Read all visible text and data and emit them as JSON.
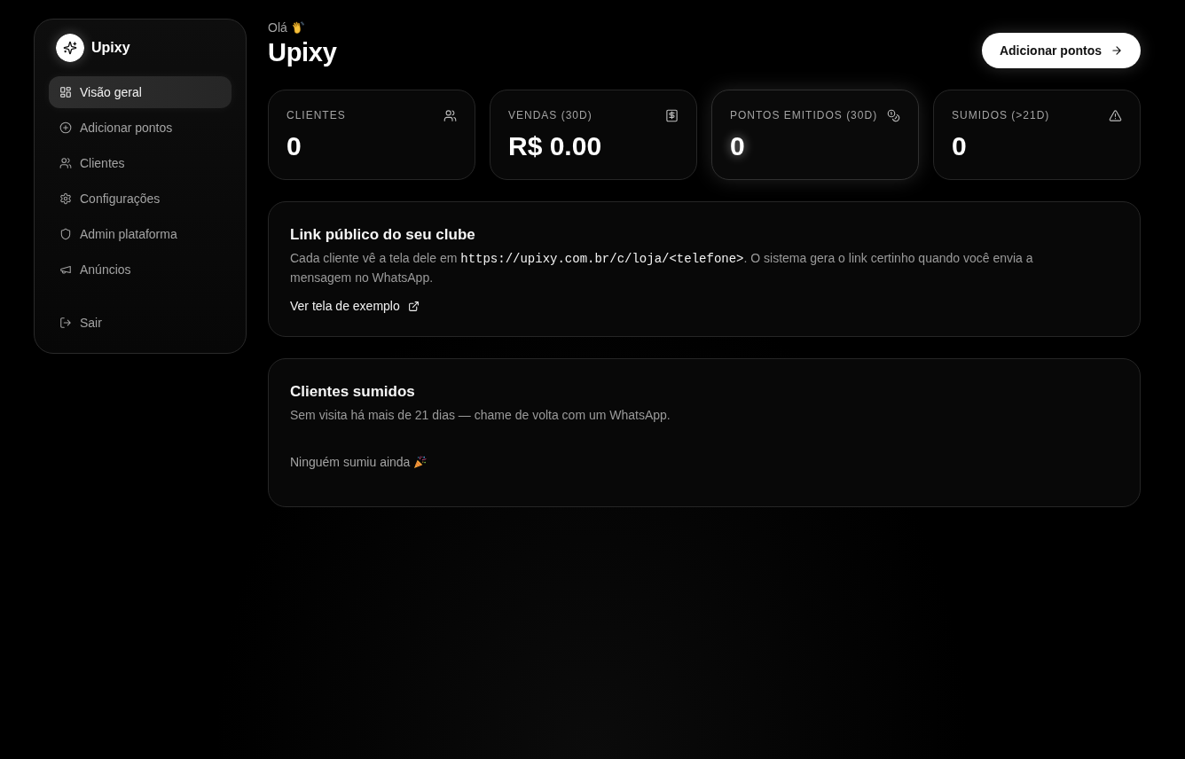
{
  "sidebar": {
    "brand": "Upixy",
    "items": [
      {
        "label": "Visão geral",
        "selected": true
      },
      {
        "label": "Adicionar pontos",
        "selected": false
      },
      {
        "label": "Clientes",
        "selected": false
      },
      {
        "label": "Configurações",
        "selected": false
      },
      {
        "label": "Admin plataforma",
        "selected": false
      },
      {
        "label": "Anúncios",
        "selected": false
      }
    ],
    "logout": {
      "label": "Sair"
    }
  },
  "header": {
    "greeting": "Olá",
    "title": "Upixy",
    "action": "Adicionar pontos"
  },
  "stats": [
    {
      "label": "CLIENTES",
      "value": "0",
      "highlighted": false
    },
    {
      "label": "VENDAS (30D)",
      "value": "R$ 0.00",
      "highlighted": false
    },
    {
      "label": "PONTOS EMITIDOS (30D)",
      "value": "0",
      "highlighted": true
    },
    {
      "label": "SUMIDOS (>21D)",
      "value": "0",
      "highlighted": false
    }
  ],
  "public_link": {
    "title": "Link público do seu clube",
    "description": [
      {
        "kind": "text",
        "text": "Cada cliente vê a tela dele em "
      },
      {
        "kind": "code",
        "text": "https://upixy.com.br/c/loja/<telefone>"
      },
      {
        "kind": "text",
        "text": ". O sistema gera o link certinho quando você envia a mensagem no WhatsApp."
      }
    ],
    "link": "Ver tela de exemplo"
  },
  "inactive_clients": {
    "title": "Clientes sumidos",
    "description": "Sem visita há mais de 21 dias — chame de volta com um WhatsApp.",
    "empty_message": "Ninguém sumiu ainda"
  }
}
